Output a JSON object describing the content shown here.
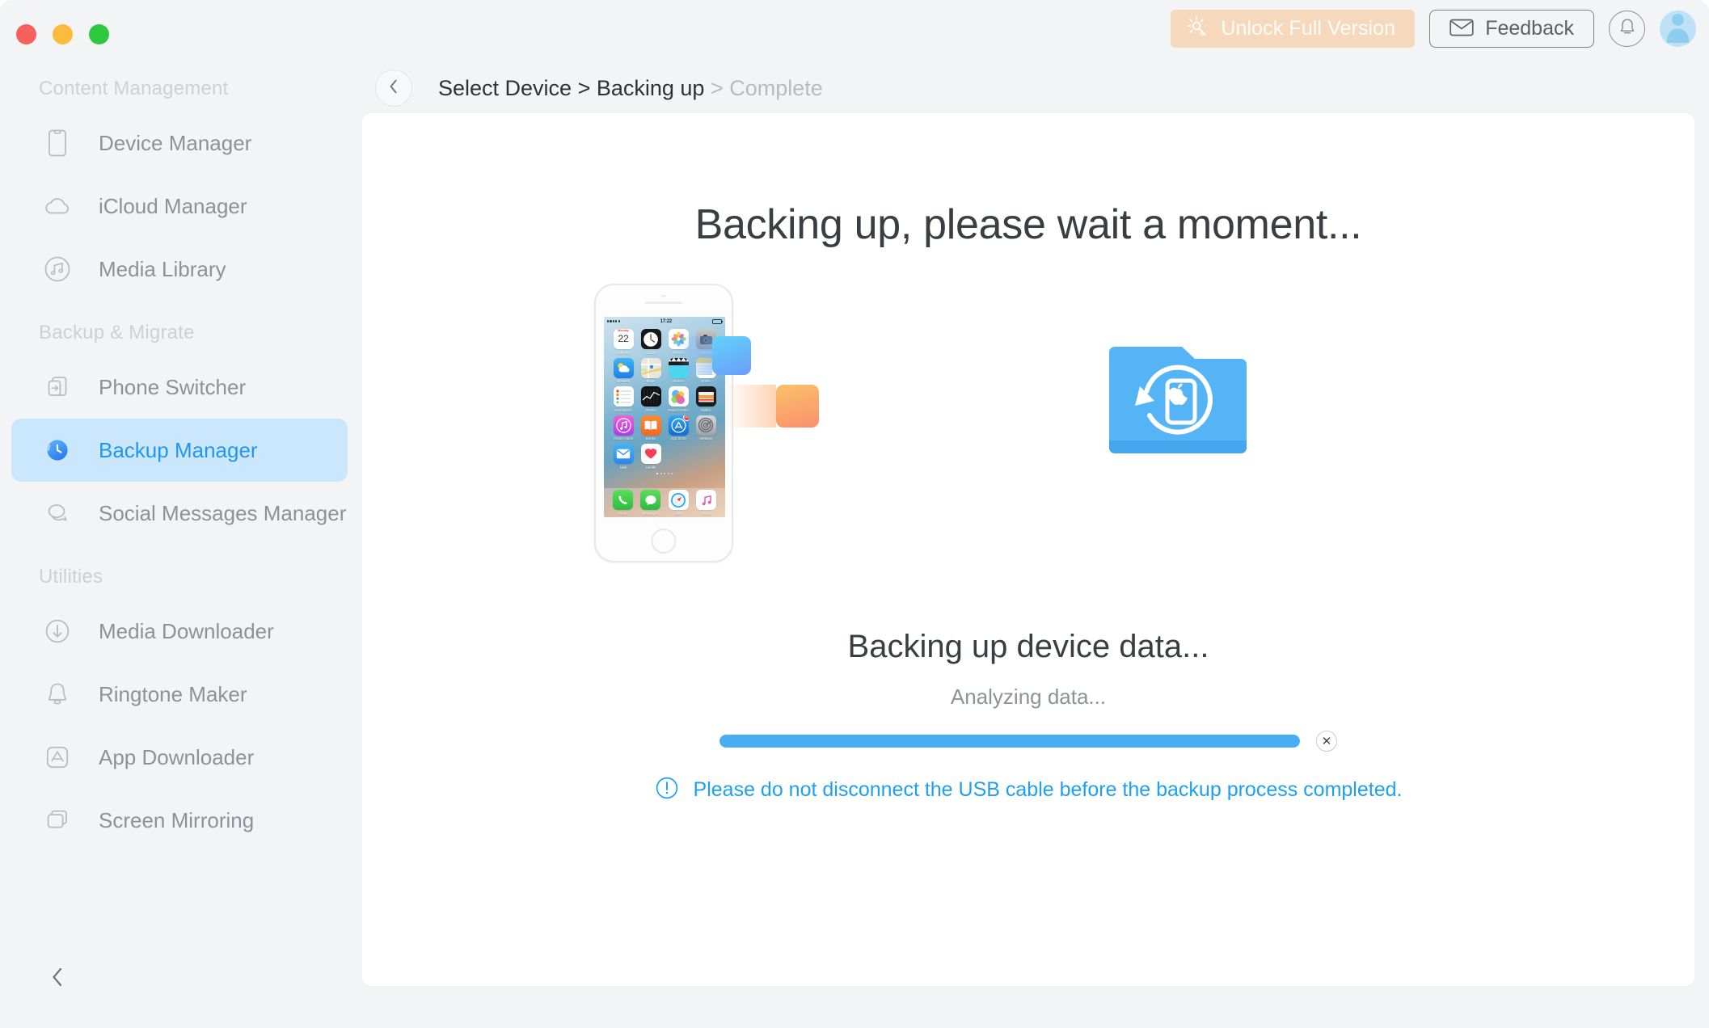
{
  "titlebar": {
    "traffic_lights": [
      "close",
      "minimize",
      "zoom"
    ],
    "unlock_label": "Unlock Full Version",
    "feedback_label": "Feedback",
    "notification_icon": "bell-icon",
    "avatar_icon": "user-avatar-icon"
  },
  "sidebar": {
    "groups": [
      {
        "title": "Content Management",
        "items": [
          {
            "label": "Device Manager",
            "icon": "phone-icon",
            "active": false
          },
          {
            "label": "iCloud Manager",
            "icon": "cloud-icon",
            "active": false
          },
          {
            "label": "Media Library",
            "icon": "music-circle-icon",
            "active": false
          }
        ]
      },
      {
        "title": "Backup & Migrate",
        "items": [
          {
            "label": "Phone Switcher",
            "icon": "phone-transfer-icon",
            "active": false
          },
          {
            "label": "Backup Manager",
            "icon": "clock-backup-icon",
            "active": true
          },
          {
            "label": "Social Messages Manager",
            "icon": "chat-bubbles-icon",
            "active": false
          }
        ]
      },
      {
        "title": "Utilities",
        "items": [
          {
            "label": "Media Downloader",
            "icon": "download-circle-icon",
            "active": false
          },
          {
            "label": "Ringtone Maker",
            "icon": "bell-outline-icon",
            "active": false
          },
          {
            "label": "App Downloader",
            "icon": "appstore-icon",
            "active": false
          },
          {
            "label": "Screen Mirroring",
            "icon": "screens-icon",
            "active": false
          }
        ]
      }
    ],
    "collapse_icon": "chevron-left-icon"
  },
  "breadcrumb": {
    "back_icon": "chevron-left-icon",
    "step1": "Select Device >",
    "step2": "Backing up",
    "step3": "> Complete"
  },
  "main": {
    "headline": "Backing up, please wait a moment...",
    "progress_title": "Backing up device data...",
    "progress_sub": "Analyzing data...",
    "progress_percent": 100,
    "cancel_icon": "close-icon",
    "warning_icon": "exclamation-circle-icon",
    "warning_text": "Please do not disconnect the USB cable before the backup process completed."
  },
  "illustration": {
    "phone": {
      "status_time": "17:22",
      "apps": [
        {
          "name": "Calendar",
          "day": "Monday",
          "date": "22"
        },
        {
          "name": "Clock"
        },
        {
          "name": "Photos"
        },
        {
          "name": "Camera"
        },
        {
          "name": "Weather"
        },
        {
          "name": "Maps"
        },
        {
          "name": "Videos"
        },
        {
          "name": "Notes"
        },
        {
          "name": "Reminders"
        },
        {
          "name": "Stocks"
        },
        {
          "name": "Game Center"
        },
        {
          "name": "Wallet"
        },
        {
          "name": "iTunes Store"
        },
        {
          "name": "Books"
        },
        {
          "name": "App Store",
          "badge": "33"
        },
        {
          "name": "Settings"
        },
        {
          "name": "Mail"
        },
        {
          "name": "Health"
        }
      ],
      "dock": [
        "Phone",
        "Messages",
        "Safari",
        "Music"
      ]
    },
    "fly_blocks": [
      "blue-data-block",
      "orange-data-block"
    ],
    "folder_icon": "backup-folder-icon"
  },
  "colors": {
    "accent_blue": "#2196f3",
    "progress_blue": "#47aef4",
    "active_pill": "#cbe7fd",
    "unlock_peach": "#f6d8bc",
    "sidebar_bg": "#f3f4f6",
    "panel_bg": "#ffffff",
    "muted_text": "#8d9298",
    "group_title": "#cdd0d4"
  }
}
